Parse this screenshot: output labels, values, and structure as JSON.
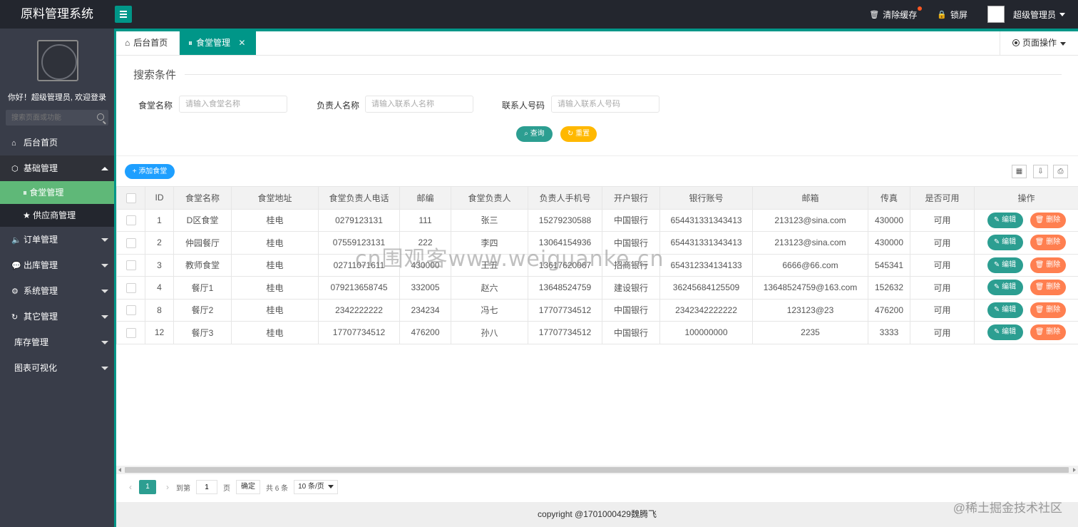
{
  "app": {
    "title": "原料管理系统"
  },
  "header": {
    "clear_cache": "清除缓存",
    "lock_screen": "锁屏",
    "user_name": "超级管理员"
  },
  "sidebar": {
    "welcome": "你好！超级管理员, 欢迎登录",
    "search_placeholder": "搜索页面或功能",
    "items": [
      {
        "label": "后台首页",
        "icon": "home-icon"
      },
      {
        "label": "基础管理",
        "icon": "cube-icon",
        "expanded": true,
        "children": [
          {
            "label": "食堂管理",
            "icon": "circle-pause-icon",
            "active": true
          },
          {
            "label": "供应商管理",
            "icon": "star-icon"
          }
        ]
      },
      {
        "label": "订单管理",
        "icon": "volume-icon"
      },
      {
        "label": "出库管理",
        "icon": "chat-icon"
      },
      {
        "label": "系统管理",
        "icon": "gear-icon"
      },
      {
        "label": "其它管理",
        "icon": "cycle-icon"
      },
      {
        "label": "库存管理"
      },
      {
        "label": "图表可视化"
      }
    ]
  },
  "tabs": {
    "home": "后台首页",
    "active": "食堂管理",
    "page_ops": "页面操作"
  },
  "search": {
    "legend": "搜索条件",
    "fields": [
      {
        "label": "食堂名称",
        "placeholder": "请输入食堂名称"
      },
      {
        "label": "负责人名称",
        "placeholder": "请输入联系人名称"
      },
      {
        "label": "联系人号码",
        "placeholder": "请输入联系人号码"
      }
    ],
    "query_button": "查询",
    "reset_button": "重置"
  },
  "table": {
    "add_button": "添加食堂",
    "columns": [
      "ID",
      "食堂名称",
      "食堂地址",
      "食堂负责人电话",
      "邮编",
      "食堂负责人",
      "负责人手机号",
      "开户银行",
      "银行账号",
      "邮箱",
      "传真",
      "是否可用",
      "操作"
    ],
    "rows": [
      [
        "1",
        "D区食堂",
        "桂电",
        "0279123131",
        "111",
        "张三",
        "15279230588",
        "中国银行",
        "654431331343413",
        "213123@sina.com",
        "430000",
        "可用"
      ],
      [
        "2",
        "仲园餐厅",
        "桂电",
        "07559123131",
        "222",
        "李四",
        "13064154936",
        "中国银行",
        "654431331343413",
        "213123@sina.com",
        "430000",
        "可用"
      ],
      [
        "3",
        "教师食堂",
        "桂电",
        "02711071611",
        "430000",
        "王五",
        "13617620067",
        "招商银行",
        "654312334134133",
        "6666@66.com",
        "545341",
        "可用"
      ],
      [
        "4",
        "餐厅1",
        "桂电",
        "079213658745",
        "332005",
        "赵六",
        "13648524759",
        "建设银行",
        "36245684125509",
        "13648524759@163.com",
        "152632",
        "可用"
      ],
      [
        "8",
        "餐厅2",
        "桂电",
        "2342222222",
        "234234",
        "冯七",
        "17707734512",
        "中国银行",
        "2342342222222",
        "123123@23",
        "476200",
        "可用"
      ],
      [
        "12",
        "餐厅3",
        "桂电",
        "17707734512",
        "476200",
        "孙八",
        "17707734512",
        "中国银行",
        "100000000",
        "2235",
        "3333",
        "可用"
      ]
    ],
    "edit_label": "编辑",
    "delete_label": "删除"
  },
  "pager": {
    "current": "1",
    "goto_label": "到第",
    "page_input": "1",
    "page_unit": "页",
    "confirm": "确定",
    "total": "共 6 条",
    "page_size": "10 条/页"
  },
  "footer": {
    "copyright": "copyright @1701000429魏腾飞"
  },
  "watermarks": {
    "center": "cn围观客www.weiguanke.cn",
    "corner": "@稀土掘金技术社区"
  },
  "colors": {
    "primary": "#009688",
    "header_bg": "#23262e",
    "sidebar_bg": "#393d49",
    "active_sub": "#5fb878",
    "add_button": "#1e9fff",
    "reset": "#ffb800",
    "delete": "#ff7f50"
  }
}
